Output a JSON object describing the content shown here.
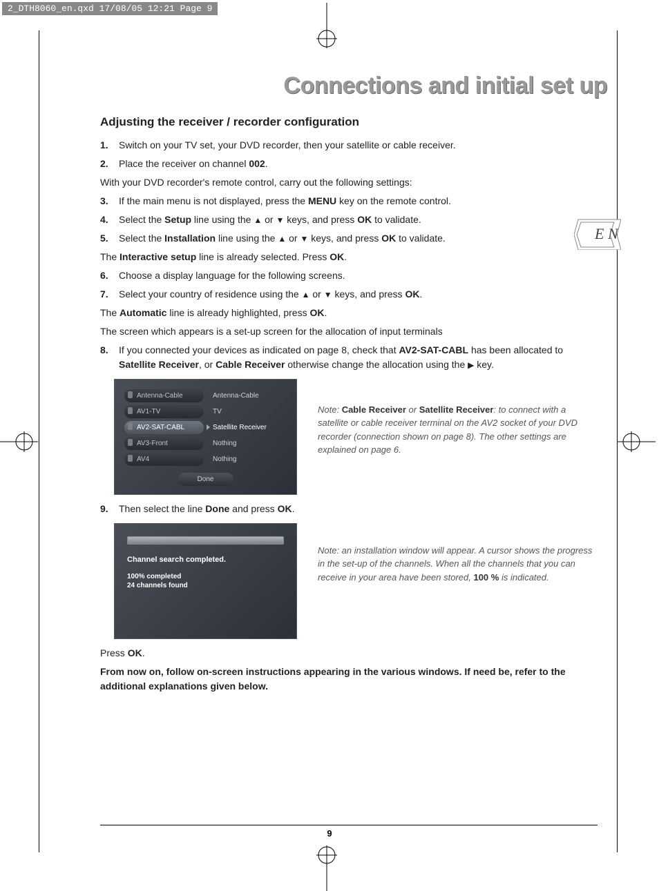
{
  "printHeader": "2_DTH8060_en.qxd  17/08/05  12:21  Page 9",
  "pageTitle": "Connections and initial set up",
  "langBadge": "E N",
  "subsectionTitle": "Adjusting the receiver / recorder configuration",
  "steps": {
    "s1": {
      "num": "1.",
      "a": "Switch on your TV set, your DVD recorder, then your satellite or cable receiver."
    },
    "s2": {
      "num": "2.",
      "a": "Place the receiver on channel ",
      "b": "002",
      "c": "."
    },
    "p_remote": "With your DVD recorder's remote control, carry out the following settings:",
    "s3": {
      "num": "3.",
      "a": "If the main menu is not displayed, press the ",
      "b": "MENU",
      "c": " key on the remote control."
    },
    "s4": {
      "num": "4.",
      "a": "Select the ",
      "b": "Setup",
      "c": " line using the  ",
      "d": "  or  ",
      "e": "  keys, and press ",
      "f": "OK",
      "g": " to validate."
    },
    "s5": {
      "num": "5.",
      "a": "Select the ",
      "b": "Installation",
      "c": " line using the  ",
      "d": "  or  ",
      "e": "  keys, and press ",
      "f": "OK",
      "g": " to validate."
    },
    "p_interactive_a": "The ",
    "p_interactive_b": "Interactive setup",
    "p_interactive_c": " line is already selected. Press ",
    "p_interactive_d": "OK",
    "p_interactive_e": ".",
    "s6": {
      "num": "6.",
      "a": "Choose a display language for the following screens."
    },
    "s7": {
      "num": "7.",
      "a": "Select your country of residence using the  ",
      "b": "  or  ",
      "c": "  keys, and press ",
      "d": "OK",
      "e": "."
    },
    "p_auto_a": "The ",
    "p_auto_b": "Automatic",
    "p_auto_c": " line is already highlighted, press ",
    "p_auto_d": "OK",
    "p_auto_e": ".",
    "p_screen": "The screen which appears is a set-up screen for the allocation of input terminals",
    "s8": {
      "num": "8.",
      "a": "If you connected your devices as indicated on page 8, check that ",
      "b": "AV2-SAT-CABL",
      "c": " has been allocated to ",
      "d": "Satellite Receiver",
      "e": ", or ",
      "f": "Cable Receiver",
      "g": " otherwise change the allocation using the  ",
      "h": "  key."
    },
    "s9": {
      "num": "9.",
      "a": "Then select the line ",
      "b": "Done",
      "c": " and press ",
      "d": "OK",
      "e": "."
    },
    "p_pressok_a": "Press ",
    "p_pressok_b": "OK",
    "p_pressok_c": ".",
    "final": "From now on, follow on-screen instructions appearing in the various windows. If need be, refer to the additional explanations given below."
  },
  "embed1": {
    "rows": [
      {
        "l": "Antenna-Cable",
        "r": "Antenna-Cable",
        "active": false
      },
      {
        "l": "AV1-TV",
        "r": "TV",
        "active": false
      },
      {
        "l": "AV2-SAT-CABL",
        "r": "Satellite Receiver",
        "active": true
      },
      {
        "l": "AV3-Front",
        "r": "Nothing",
        "active": false
      },
      {
        "l": "AV4",
        "r": "Nothing",
        "active": false
      }
    ],
    "done": "Done"
  },
  "note1": {
    "a": "Note: ",
    "b": "Cable Receiver",
    "c": " or ",
    "d": "Satellite Receiver",
    "e": ": to connect with a satellite or cable receiver terminal on the AV2 socket of your DVD recorder (connection shown on page 8). The other settings are explained on page 6."
  },
  "embed2": {
    "line1": "Channel search completed.",
    "line2a": "100% completed",
    "line2b": "24 channels found"
  },
  "note2": {
    "a": "Note: an installation window will appear. A cursor shows the progress in the set-up of the channels. When all the channels that you can receive in your area have been stored, ",
    "b": "100 %",
    "c": " is indicated."
  },
  "pageNumber": "9"
}
